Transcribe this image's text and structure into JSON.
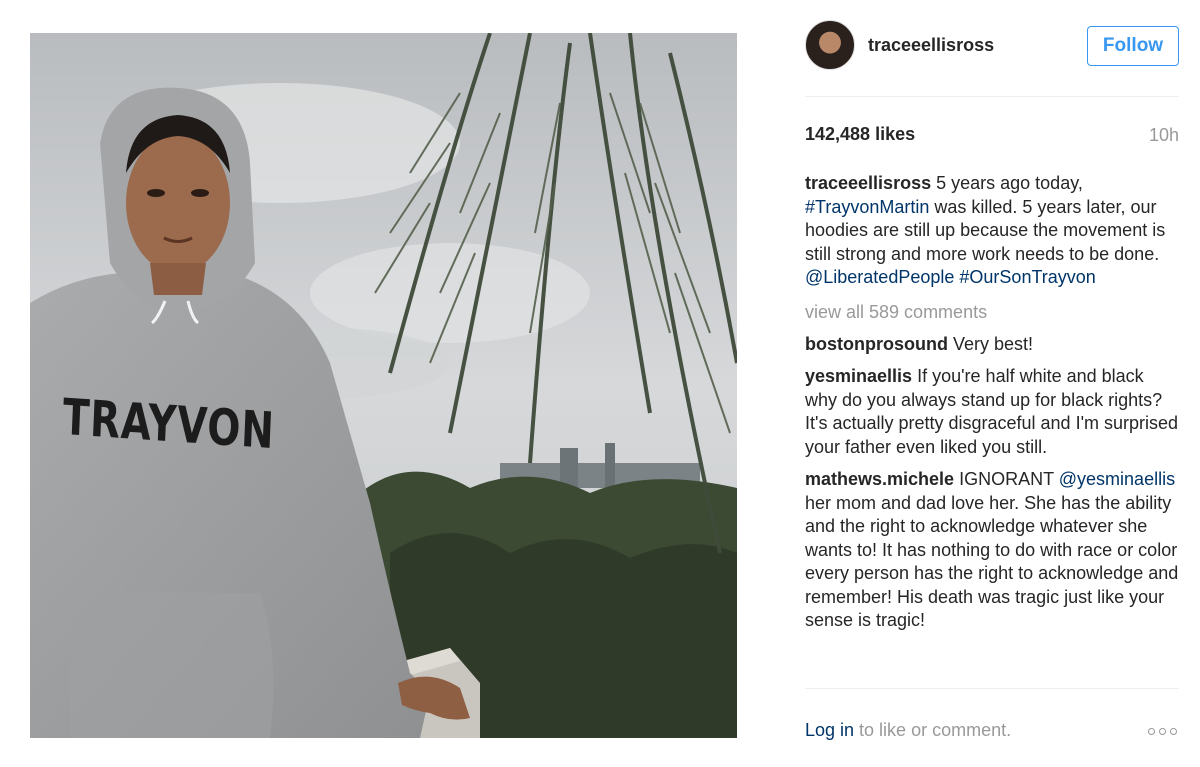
{
  "post": {
    "image_alt": "Woman in grey TRAYVON hoodie beside a palm tree",
    "image_print": "TRAYVON"
  },
  "header": {
    "username": "traceeellisross",
    "follow_label": "Follow"
  },
  "stats": {
    "likes": "142,488 likes",
    "time_ago": "10h"
  },
  "caption": {
    "author": "traceeellisross",
    "text_1": "5 years ago today, ",
    "hashtag_1": "#TrayvonMartin",
    "text_2": " was killed. 5 years later, our hoodies are still up because the movement is still strong and more work needs to be done. ",
    "mention_1": "@LiberatedPeople",
    "text_3": " ",
    "hashtag_2": "#OurSonTrayvon"
  },
  "view_all_label": "view all 589 comments",
  "comments": [
    {
      "author": "bostonprosound",
      "text": "Very best!"
    },
    {
      "author": "yesminaellis",
      "text": "If you're half white and black why do you always stand up for black rights? It's actually pretty disgraceful and I'm surprised your father even liked you still."
    },
    {
      "author": "mathews.michele",
      "text_1": "IGNORANT ",
      "mention": "@yesminaellis",
      "text_2": " her mom and dad love her. She has the ability and the right to acknowledge whatever she wants to! It has nothing to do with race or color every person has the right to acknowledge and remember! His death was tragic just like your sense is tragic!"
    }
  ],
  "footer": {
    "login_link": "Log in",
    "login_text": " to like or comment."
  },
  "icons": {
    "more": "more-options-icon"
  },
  "colors": {
    "accent": "#3897f0",
    "link": "#003569",
    "muted": "#999999",
    "text": "#262626"
  }
}
